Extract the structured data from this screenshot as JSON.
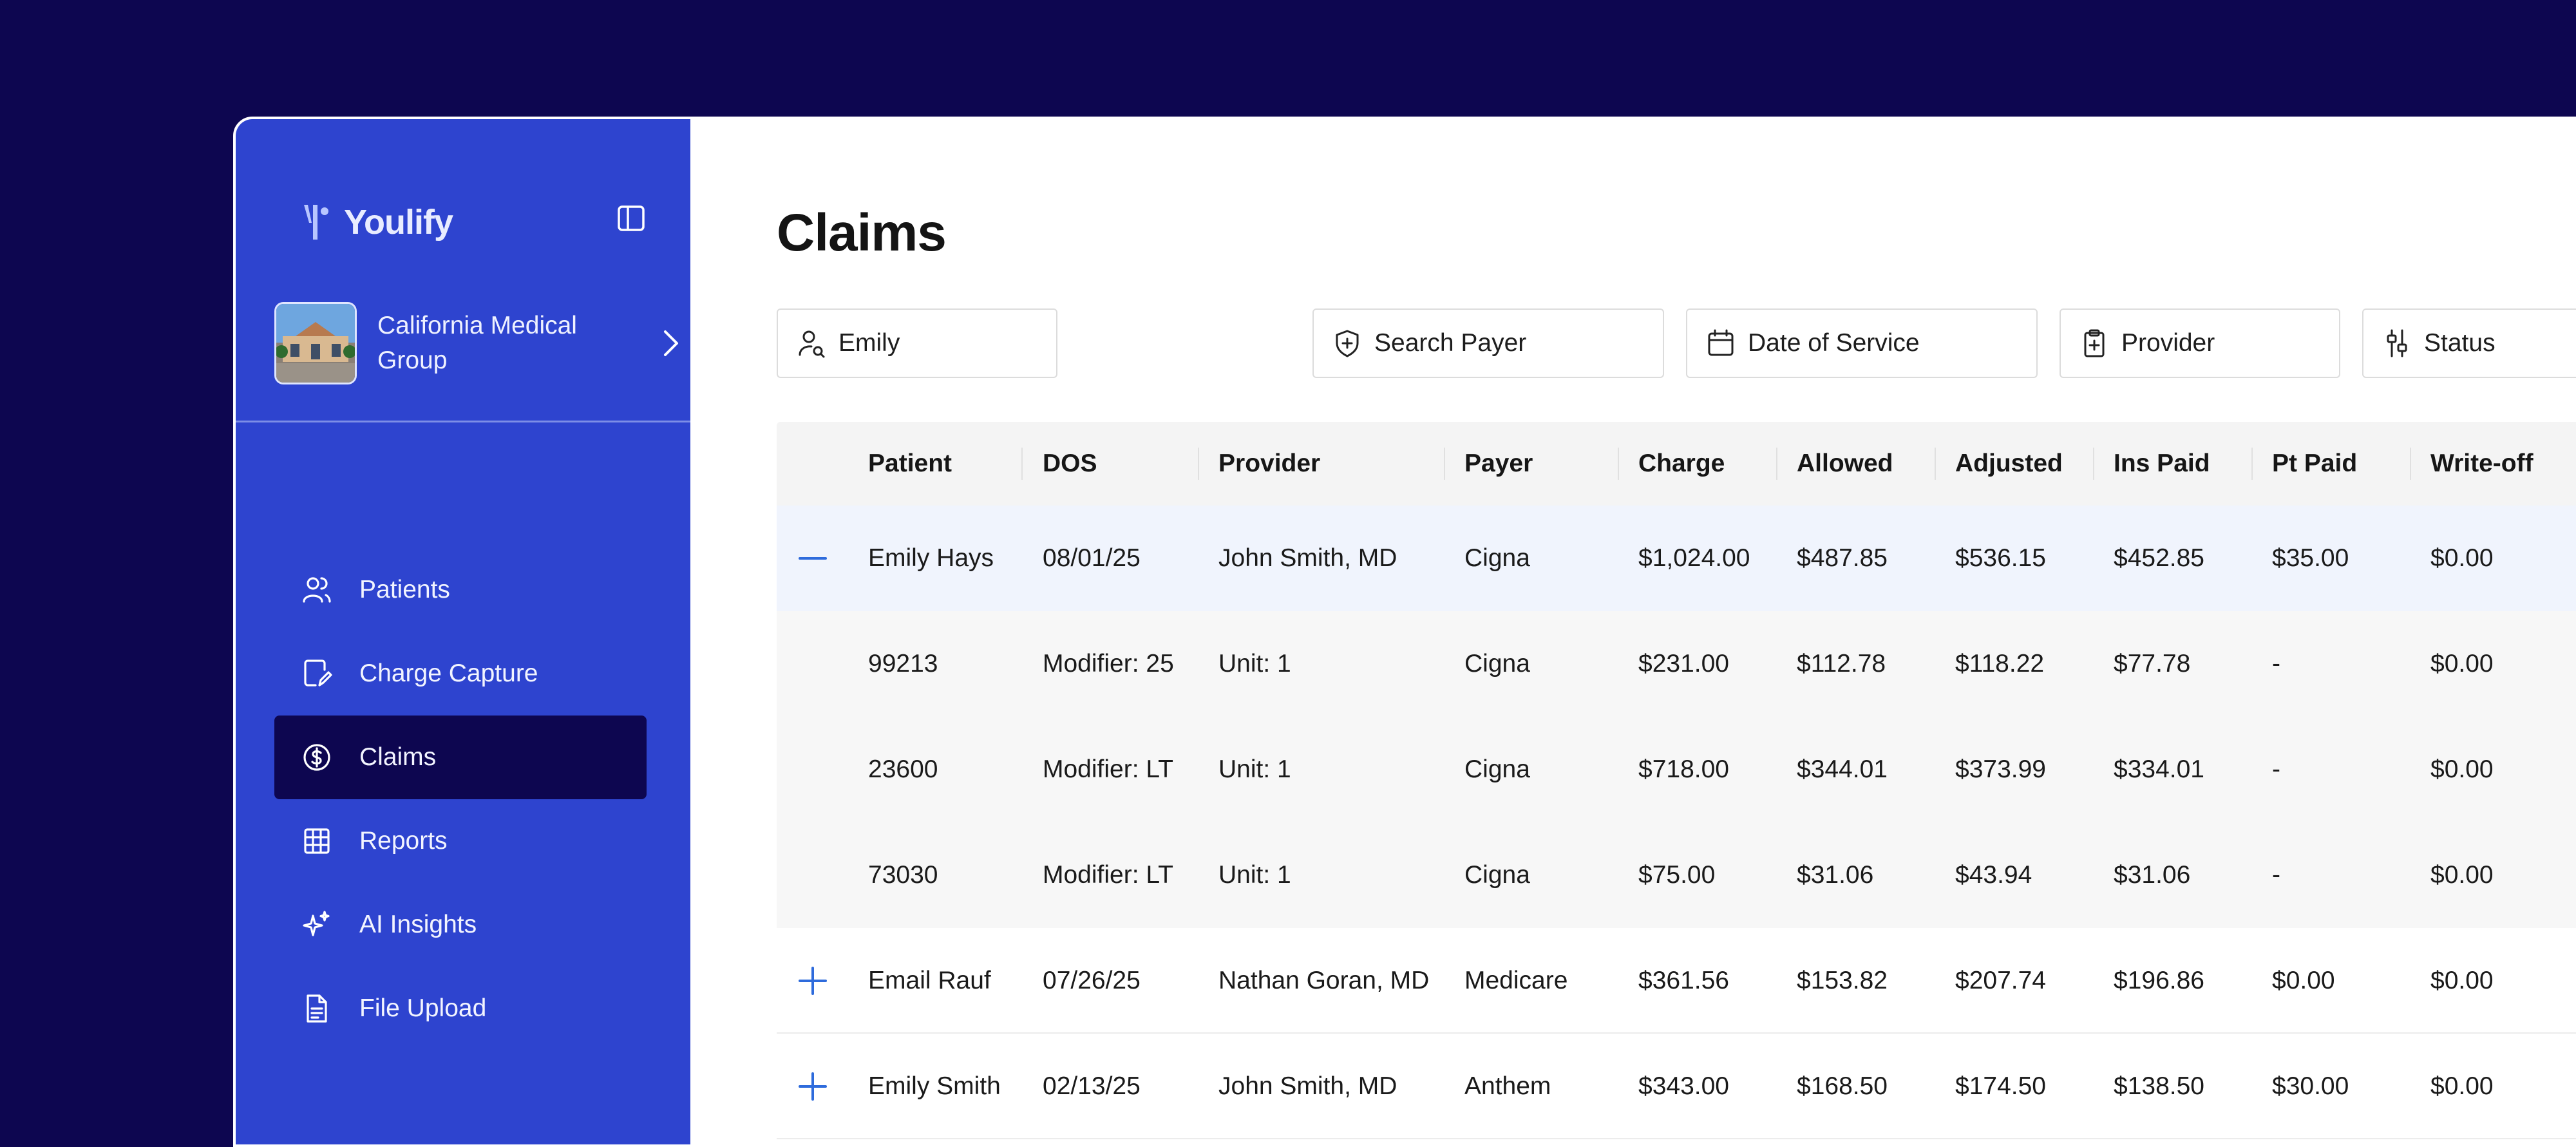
{
  "app": {
    "brand": "Youlify"
  },
  "colors": {
    "sidebar": "#2e44cf",
    "active_nav": "#0d0650",
    "accent": "#2e6bdc",
    "background": "#0d0650"
  },
  "org": {
    "name": "California Medical Group"
  },
  "nav": [
    {
      "label": "Patients",
      "icon": "users-icon",
      "active": false
    },
    {
      "label": "Charge Capture",
      "icon": "edit-document-icon",
      "active": false
    },
    {
      "label": "Claims",
      "icon": "dollar-circle-icon",
      "active": true
    },
    {
      "label": "Reports",
      "icon": "table-icon",
      "active": false
    },
    {
      "label": "AI Insights",
      "icon": "sparkles-icon",
      "active": false
    },
    {
      "label": "File Upload",
      "icon": "file-icon",
      "active": false
    }
  ],
  "page": {
    "title": "Claims"
  },
  "filters": {
    "patient": {
      "value": "Emily",
      "icon": "user-search-icon"
    },
    "payer": {
      "placeholder": "Search Payer",
      "icon": "shield-plus-icon"
    },
    "dos": {
      "placeholder": "Date of Service",
      "icon": "calendar-icon"
    },
    "provider": {
      "placeholder": "Provider",
      "icon": "clipboard-plus-icon"
    },
    "status": {
      "placeholder": "Status",
      "icon": "sliders-icon"
    }
  },
  "table": {
    "headers": {
      "patient": "Patient",
      "dos": "DOS",
      "provider": "Provider",
      "payer": "Payer",
      "charge": "Charge",
      "allowed": "Allowed",
      "adjusted": "Adjusted",
      "ins_paid": "Ins Paid",
      "pt_paid": "Pt Paid",
      "writeoff": "Write-off"
    },
    "rows": [
      {
        "patient": "Emily Hays",
        "dos": "08/01/25",
        "provider": "John Smith, MD",
        "payer": "Cigna",
        "charge": "$1,024.00",
        "allowed": "$487.85",
        "adjusted": "$536.15",
        "ins_paid": "$452.85",
        "pt_paid": "$35.00",
        "writeoff": "$0.00",
        "toggle": "minus-icon"
      },
      {
        "patient": "99213",
        "dos": "Modifier: 25",
        "provider": "Unit: 1",
        "payer": "Cigna",
        "charge": "$231.00",
        "allowed": "$112.78",
        "adjusted": "$118.22",
        "ins_paid": "$77.78",
        "pt_paid": "-",
        "writeoff": "$0.00"
      },
      {
        "patient": "23600",
        "dos": "Modifier: LT",
        "provider": "Unit: 1",
        "payer": "Cigna",
        "charge": "$718.00",
        "allowed": "$344.01",
        "adjusted": "$373.99",
        "ins_paid": "$334.01",
        "pt_paid": "-",
        "writeoff": "$0.00"
      },
      {
        "patient": "73030",
        "dos": "Modifier: LT",
        "provider": "Unit: 1",
        "payer": "Cigna",
        "charge": "$75.00",
        "allowed": "$31.06",
        "adjusted": "$43.94",
        "ins_paid": "$31.06",
        "pt_paid": "-",
        "writeoff": "$0.00"
      },
      {
        "patient": "Email Rauf",
        "dos": "07/26/25",
        "provider": "Nathan Goran, MD",
        "payer": "Medicare",
        "charge": "$361.56",
        "allowed": "$153.82",
        "adjusted": "$207.74",
        "ins_paid": "$196.86",
        "pt_paid": "$0.00",
        "writeoff": "$0.00",
        "toggle": "plus-icon"
      },
      {
        "patient": "Emily Smith",
        "dos": "02/13/25",
        "provider": "John Smith, MD",
        "payer": "Anthem",
        "charge": "$343.00",
        "allowed": "$168.50",
        "adjusted": "$174.50",
        "ins_paid": "$138.50",
        "pt_paid": "$30.00",
        "writeoff": "$0.00",
        "toggle": "plus-icon"
      }
    ]
  }
}
